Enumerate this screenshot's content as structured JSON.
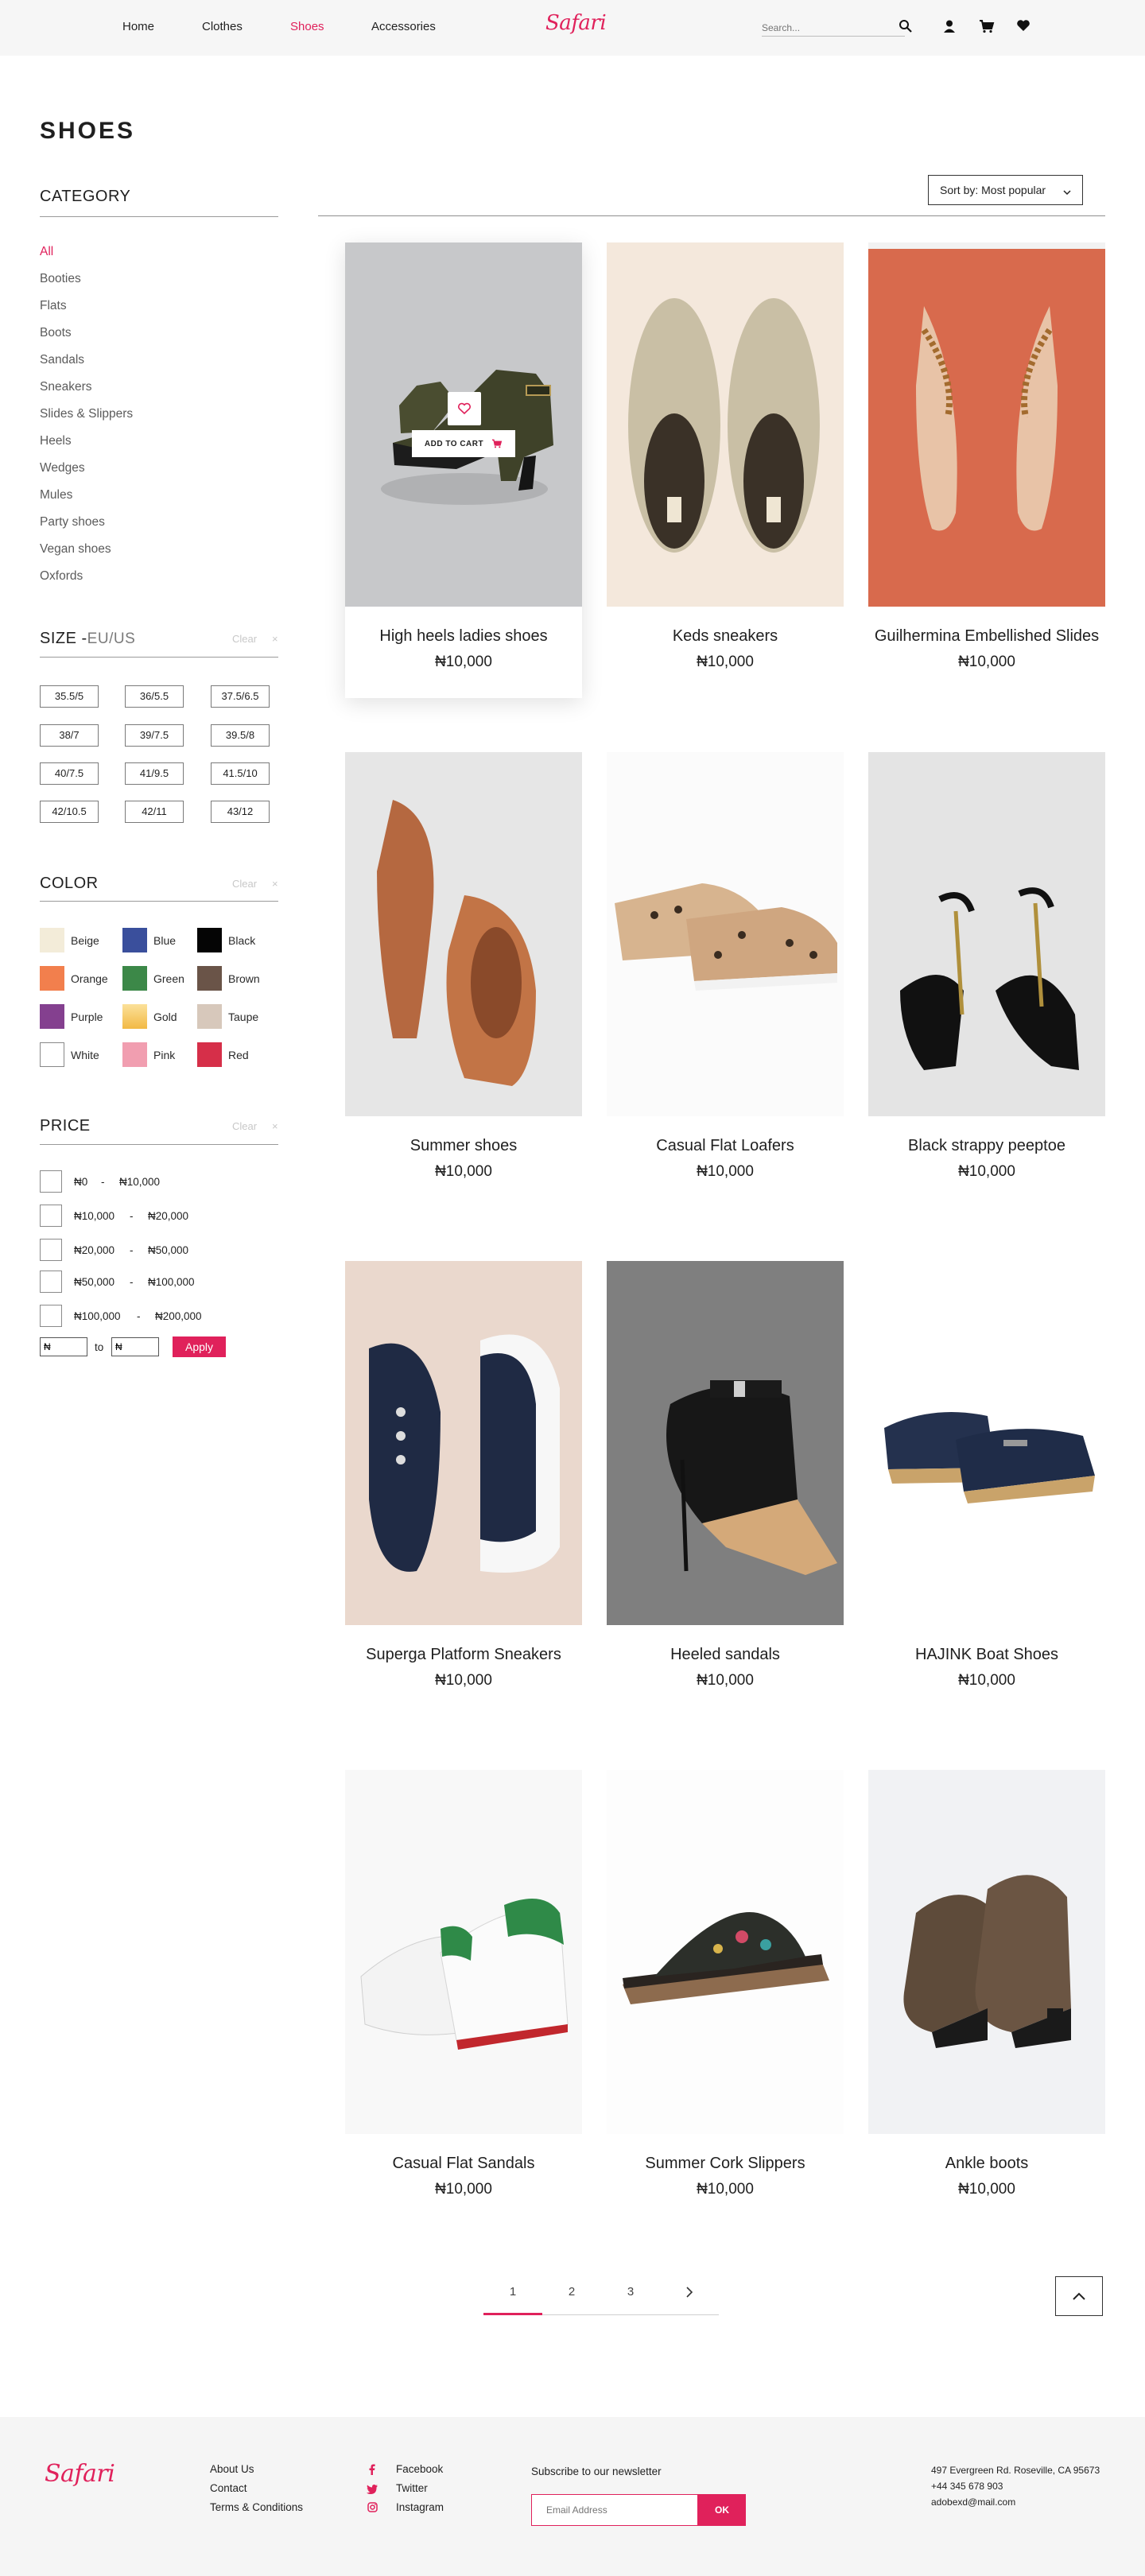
{
  "nav": {
    "links": [
      "Home",
      "Clothes",
      "Shoes",
      "Accessories"
    ],
    "active": "Shoes",
    "logo": "Safari",
    "search_placeholder": "Search..."
  },
  "page": {
    "title": "SHOES"
  },
  "category": {
    "title": "CATEGORY",
    "items": [
      "All",
      "Booties",
      "Flats",
      "Boots",
      "Sandals",
      "Sneakers",
      "Slides & Slippers",
      "Heels",
      "Wedges",
      "Mules",
      "Party shoes",
      "Vegan shoes",
      "Oxfords"
    ],
    "active": "All"
  },
  "size": {
    "title": "SIZE -",
    "subtitle": "EU/US",
    "clear": "Clear",
    "close": "×",
    "options": [
      "35.5/5",
      "36/5.5",
      "37.5/6.5",
      "38/7",
      "39/7.5",
      "39.5/8",
      "40/7.5",
      "41/9.5",
      "41.5/10",
      "42/10.5",
      "42/11",
      "43/12"
    ]
  },
  "color": {
    "title": "COLOR",
    "clear": "Clear",
    "close": "×",
    "options": [
      {
        "name": "Beige",
        "hex": "#f3ecd9"
      },
      {
        "name": "Blue",
        "hex": "#3a4f9c"
      },
      {
        "name": "Black",
        "hex": "#050505"
      },
      {
        "name": "Orange",
        "hex": "#f27f4d"
      },
      {
        "name": "Green",
        "hex": "#3c8848"
      },
      {
        "name": "Brown",
        "hex": "#6a5448"
      },
      {
        "name": "Purple",
        "hex": "#84408f"
      },
      {
        "name": "Gold",
        "hex": "#f5c86a"
      },
      {
        "name": "Taupe",
        "hex": "#d7c8bb"
      },
      {
        "name": "White",
        "hex": "#ffffff"
      },
      {
        "name": "Pink",
        "hex": "#f19eb0"
      },
      {
        "name": "Red",
        "hex": "#d62f49"
      }
    ]
  },
  "price": {
    "title": "PRICE",
    "clear": "Clear",
    "close": "×",
    "ranges": [
      [
        "₦0",
        "-",
        "₦10,000"
      ],
      [
        "₦10,000",
        "-",
        "₦20,000"
      ],
      [
        "₦20,000",
        "-",
        "₦50,000"
      ],
      [
        "₦50,000",
        "-",
        "₦100,000"
      ],
      [
        "₦100,000",
        "-",
        "₦200,000"
      ]
    ],
    "min_value": "₦",
    "to": "to",
    "max_value": "₦",
    "apply": "Apply"
  },
  "sort": {
    "label": "Sort by: Most popular"
  },
  "products": [
    {
      "name": "High heels ladies shoes",
      "price": "₦10,000",
      "add_to_cart": "ADD TO CART"
    },
    {
      "name": "Keds sneakers",
      "price": "₦10,000"
    },
    {
      "name": "Guilhermina Embellished Slides",
      "price": "₦10,000"
    },
    {
      "name": "Summer shoes",
      "price": "₦10,000"
    },
    {
      "name": "Casual Flat Loafers",
      "price": "₦10,000"
    },
    {
      "name": "Black strappy peeptoe",
      "price": "₦10,000"
    },
    {
      "name": "Superga Platform Sneakers",
      "price": "₦10,000"
    },
    {
      "name": "Heeled sandals",
      "price": "₦10,000"
    },
    {
      "name": "HAJINK Boat Shoes",
      "price": "₦10,000"
    },
    {
      "name": "Casual Flat Sandals",
      "price": "₦10,000"
    },
    {
      "name": "Summer Cork Slippers",
      "price": "₦10,000"
    },
    {
      "name": "Ankle boots",
      "price": "₦10,000"
    }
  ],
  "pagination": {
    "pages": [
      "1",
      "2",
      "3"
    ],
    "current": "1"
  },
  "footer": {
    "logo": "Safari",
    "links": [
      "About Us",
      "Contact",
      "Terms & Conditions"
    ],
    "social": [
      "Facebook",
      "Twitter",
      "Instagram"
    ],
    "newsletter_title": "Subscribe to our newsletter",
    "email_placeholder": "Email Address",
    "ok": "OK",
    "address": [
      "497 Evergreen Rd. Roseville, CA 95673",
      "+44 345 678 903",
      "adobexd@mail.com"
    ]
  }
}
